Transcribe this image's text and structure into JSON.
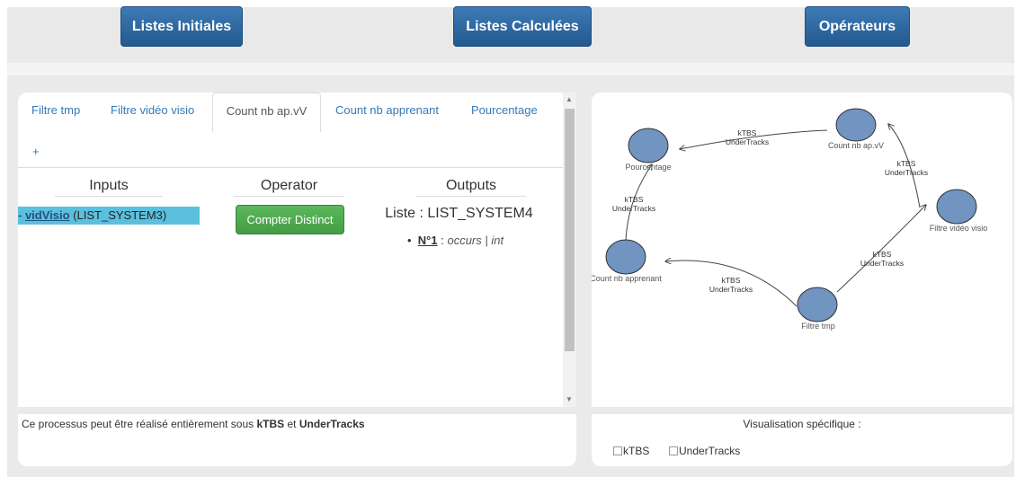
{
  "nav": {
    "buttons": [
      "Listes Initiales",
      "Listes Calculées",
      "Opérateurs"
    ]
  },
  "tabs": [
    "Filtre tmp",
    "Filtre vidéo visio",
    "Count nb ap.vV",
    "Count nb apprenant",
    "Pourcentage"
  ],
  "add_tab": "+",
  "columns": {
    "inputs": "Inputs",
    "operator": "Operator",
    "outputs": "Outputs"
  },
  "input": {
    "dash": "- ",
    "name": "vidVisio",
    "list": " (LIST_SYSTEM3)"
  },
  "operator_button": "Compter Distinct",
  "output": {
    "list_label": "Liste : LIST_SYSTEM4",
    "bullet": "•",
    "num": "N°1",
    "sep": " : ",
    "field": "occurs | int"
  },
  "footer": {
    "pre": "Ce processus peut être réalisé entièrement sous ",
    "k": "kTBS",
    "mid": " et ",
    "u": "UnderTracks"
  },
  "graph": {
    "nodes": [
      "Pourcentage",
      "Count nb ap.vV",
      "Filtre vidéo visio",
      "Count nb apprenant",
      "Filtre tmp"
    ],
    "edge_label_1": "kTBS",
    "edge_label_2": "UnderTracks",
    "node_color": "#7194c0"
  },
  "visualisation": {
    "title": "Visualisation spécifique :",
    "options": [
      "kTBS",
      "UnderTracks"
    ]
  }
}
